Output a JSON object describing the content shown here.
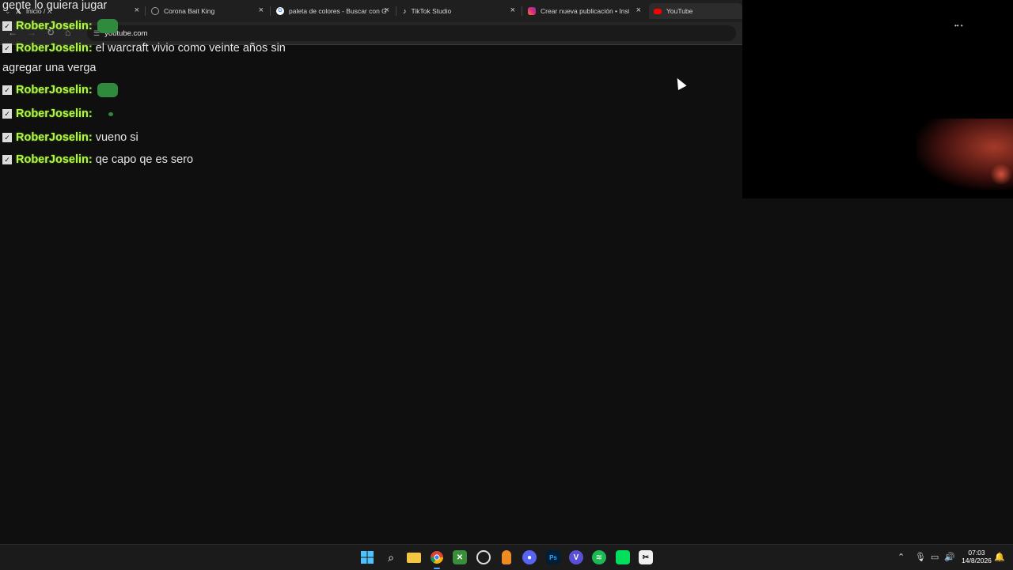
{
  "browser": {
    "tabs": [
      {
        "label": "Inicio / X",
        "icon": "x-icon",
        "color": "#ffffff"
      },
      {
        "label": "Corona Bait King",
        "icon": "globe-icon",
        "color": "#9aa0a6"
      },
      {
        "label": "paleta de colores - Buscar con G",
        "icon": "google-icon",
        "color": "#4285f4"
      },
      {
        "label": "TikTok Studio",
        "icon": "tiktok-icon",
        "color": "#ffffff"
      },
      {
        "label": "Crear nueva publicación • Insta",
        "icon": "instagram-icon",
        "color": "#e1306c"
      },
      {
        "label": "YouTube",
        "icon": "youtube-icon",
        "color": "#ff0000"
      }
    ],
    "address": "youtube.com"
  },
  "chat": {
    "messages": [
      {
        "user": "",
        "text": "gente lo quiera jugar"
      },
      {
        "user": "RoberJoselin:",
        "text": ""
      },
      {
        "user": "RoberJoselin:",
        "text": "el warcraft vivio como veinte años sin"
      },
      {
        "user": "",
        "text": "agregar una verga"
      },
      {
        "user": "RoberJoselin:",
        "text": ""
      },
      {
        "user": "RoberJoselin:",
        "text": ""
      },
      {
        "user": "RoberJoselin:",
        "text": "vueno si"
      },
      {
        "user": "RoberJoselin:",
        "text": "qe capo qe es sero"
      }
    ],
    "username_color": "#b6f34a"
  },
  "taskbar": {
    "apps": [
      "windows-start-icon",
      "search-icon",
      "file-explorer-icon",
      "chrome-icon",
      "minecraft-icon",
      "obs-icon",
      "fl-studio-icon",
      "discord-icon",
      "photoshop-icon",
      "vegas-icon",
      "spotify-icon",
      "capcut-icon",
      "capcut-desktop-icon"
    ],
    "photoshop_label": "Ps",
    "vegas_label": "V",
    "clock": {
      "time": "07:03",
      "date": "14/8/2026"
    }
  }
}
